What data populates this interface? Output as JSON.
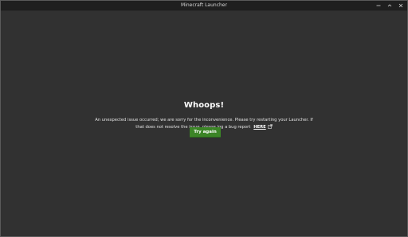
{
  "window": {
    "title": "Minecraft Launcher",
    "controls": [
      {
        "name": "minimize",
        "icon": "minimize-icon"
      },
      {
        "name": "maximize",
        "icon": "maximize-icon"
      },
      {
        "name": "close",
        "icon": "close-icon"
      }
    ]
  },
  "error": {
    "heading": "Whoops!",
    "message_line1": "An unexpected issue occurred; we are sorry for the inconvenience. Please try restarting your Launcher. If",
    "message_line2": "that does not resolve the issue, please log a bug report",
    "link_label": "HERE",
    "link_icon": "external-link-icon",
    "button_label": "Try again"
  },
  "colors": {
    "background": "#313131",
    "titlebar": "#1f1f1f",
    "accent_button": "#3c8527",
    "text": "#e2e2e2"
  }
}
